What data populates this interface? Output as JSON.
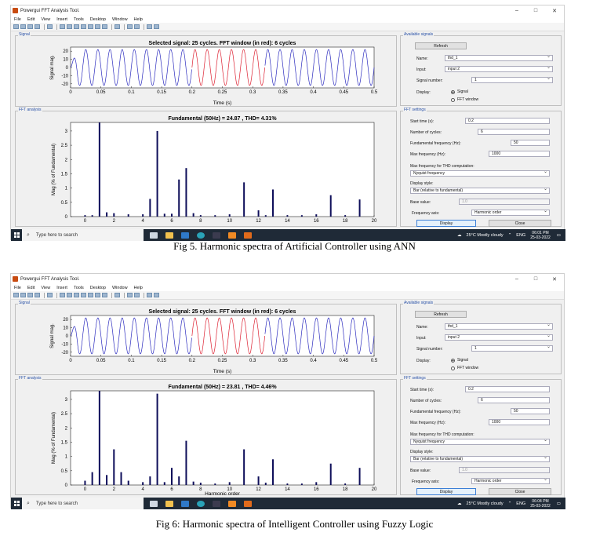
{
  "screens": [
    {
      "window_title": "Powergui FFT Analysis Tool.",
      "menu": [
        "File",
        "Edit",
        "View",
        "Insert",
        "Tools",
        "Desktop",
        "Window",
        "Help"
      ],
      "signal_panel": {
        "title": "Signal",
        "plot_title": "Selected signal: 25 cycles. FFT window (in red): 6 cycles",
        "xlabel": "Time (s)",
        "ylabel": "Signal mag.",
        "xticks": [
          "0",
          "0.05",
          "0.1",
          "0.15",
          "0.2",
          "0.25",
          "0.3",
          "0.35",
          "0.4",
          "0.45",
          "0.5"
        ],
        "yticks": [
          "20",
          "10",
          "0",
          "-10",
          "-20"
        ]
      },
      "fft_panel": {
        "title": "FFT analysis",
        "plot_title": "Fundamental (50Hz) = 24.87 , THD= 4.31%",
        "xlabel": "",
        "ylabel": "Mag (% of Fundamental)",
        "xticks": [
          "0",
          "2",
          "4",
          "6",
          "8",
          "10",
          "12",
          "14",
          "16",
          "18",
          "20"
        ],
        "yticks": [
          "3",
          "2.5",
          "2",
          "1.5",
          "1",
          "0.5",
          "0"
        ]
      },
      "available_signals": {
        "title": "Available signals",
        "refresh_label": "Refresh",
        "name_label": "Name:",
        "name_value": "thd_1",
        "input_label": "Input:",
        "input_value": "input 2",
        "signal_number_label": "Signal number:",
        "signal_number_value": "1",
        "display_label": "Display:",
        "display_signal": "Signal",
        "display_fft": "FFT window"
      },
      "fft_settings": {
        "title": "FFT settings",
        "start_time_label": "Start time (s):",
        "start_time_value": "0.2",
        "cycles_label": "Number of cycles:",
        "cycles_value": "6",
        "fund_freq_label": "Fundamental frequency (Hz):",
        "fund_freq_value": "50",
        "max_freq_label": "Max frequency (Hz):",
        "max_freq_value": "1000",
        "max_freq_thd_label": "Max frequency for THD computation:",
        "max_freq_thd_value": "Nyquist frequency",
        "display_style_label": "Display style:",
        "display_style_value": "Bar (relative to fundamental)",
        "base_value_label": "Base value:",
        "base_value_value": "1.0",
        "freq_axis_label": "Frequency axis:",
        "freq_axis_value": "Harmonic order",
        "display_button": "Display",
        "close_button": "Close"
      },
      "taskbar": {
        "search_placeholder": "Type here to search",
        "weather": "25°C  Mostly cloudy",
        "lang": "ENG",
        "time": "06:01 PM",
        "date": "25-03-2022"
      },
      "chart_data": {
        "type": "bar",
        "x": [
          0,
          0.5,
          1,
          1.5,
          2,
          3,
          4,
          4.5,
          5,
          5.5,
          6,
          6.5,
          7,
          7.5,
          8,
          9,
          10,
          11,
          12,
          12.5,
          13,
          14,
          15,
          16,
          17,
          18,
          19
        ],
        "values": [
          0.05,
          0.05,
          3.3,
          0.15,
          0.12,
          0.08,
          0.08,
          0.62,
          3.0,
          0.1,
          0.1,
          1.3,
          1.7,
          0.12,
          0.05,
          0.05,
          0.08,
          1.2,
          0.22,
          0.05,
          0.95,
          0.05,
          0.05,
          0.08,
          0.75,
          0.05,
          0.6
        ],
        "ylim": [
          0,
          3.3
        ],
        "xlim": [
          -1,
          20
        ]
      }
    },
    {
      "window_title": "Powergui FFT Analysis Tool.",
      "menu": [
        "File",
        "Edit",
        "View",
        "Insert",
        "Tools",
        "Desktop",
        "Window",
        "Help"
      ],
      "signal_panel": {
        "title": "Signal",
        "plot_title": "Selected signal: 25 cycles. FFT window (in red): 6 cycles",
        "xlabel": "Time (s)",
        "ylabel": "Signal mag.",
        "xticks": [
          "0",
          "0.05",
          "0.1",
          "0.15",
          "0.2",
          "0.25",
          "0.3",
          "0.35",
          "0.4",
          "0.45",
          "0.5"
        ],
        "yticks": [
          "20",
          "10",
          "0",
          "-10",
          "-20"
        ]
      },
      "fft_panel": {
        "title": "FFT analysis",
        "plot_title": "Fundamental (50Hz) = 23.81 , THD= 4.46%",
        "xlabel": "Harmonic order",
        "ylabel": "Mag (% of Fundamental)",
        "xticks": [
          "0",
          "2",
          "4",
          "6",
          "8",
          "10",
          "12",
          "14",
          "16",
          "18",
          "20"
        ],
        "yticks": [
          "3",
          "2.5",
          "2",
          "1.5",
          "1",
          "0.5",
          "0"
        ]
      },
      "available_signals": {
        "title": "Available signals",
        "refresh_label": "Refresh",
        "name_label": "Name:",
        "name_value": "thd_1",
        "input_label": "Input:",
        "input_value": "input 2",
        "signal_number_label": "Signal number:",
        "signal_number_value": "1",
        "display_label": "Display:",
        "display_signal": "Signal",
        "display_fft": "FFT window"
      },
      "fft_settings": {
        "title": "FFT settings",
        "start_time_label": "Start time (s):",
        "start_time_value": "0.2",
        "cycles_label": "Number of cycles:",
        "cycles_value": "6",
        "fund_freq_label": "Fundamental frequency (Hz):",
        "fund_freq_value": "50",
        "max_freq_label": "Max frequency (Hz):",
        "max_freq_value": "1000",
        "max_freq_thd_label": "Max frequency for THD computation:",
        "max_freq_thd_value": "Nyquist frequency",
        "display_style_label": "Display style:",
        "display_style_value": "Bar (relative to fundamental)",
        "base_value_label": "Base value:",
        "base_value_value": "1.0",
        "freq_axis_label": "Frequency axis:",
        "freq_axis_value": "Harmonic order",
        "display_button": "Display",
        "close_button": "Close"
      },
      "taskbar": {
        "search_placeholder": "Type here to search",
        "weather": "25°C  Mostly cloudy",
        "lang": "ENG",
        "time": "06:04 PM",
        "date": "25-03-2022"
      },
      "chart_data": {
        "type": "bar",
        "x": [
          0,
          0.5,
          1,
          1.5,
          2,
          2.5,
          3,
          4,
          4.5,
          5,
          5.5,
          6,
          6.5,
          7,
          7.5,
          8,
          9,
          10,
          11,
          12,
          12.5,
          13,
          14,
          15,
          16,
          17,
          18,
          19
        ],
        "values": [
          0.15,
          0.45,
          3.5,
          0.35,
          1.25,
          0.45,
          0.15,
          0.1,
          0.3,
          3.2,
          0.1,
          0.6,
          0.3,
          1.55,
          0.12,
          0.08,
          0.05,
          0.1,
          1.25,
          0.3,
          0.08,
          0.9,
          0.05,
          0.05,
          0.1,
          0.75,
          0.05,
          0.6
        ],
        "ylim": [
          0,
          3.3
        ],
        "xlim": [
          -1,
          20
        ]
      }
    }
  ],
  "captions": [
    "Fig 5. Harmonic spectra of Artificial Controller using ANN",
    "Fig 6: Harmonic spectra of Intelligent Controller using Fuzzy Logic"
  ]
}
